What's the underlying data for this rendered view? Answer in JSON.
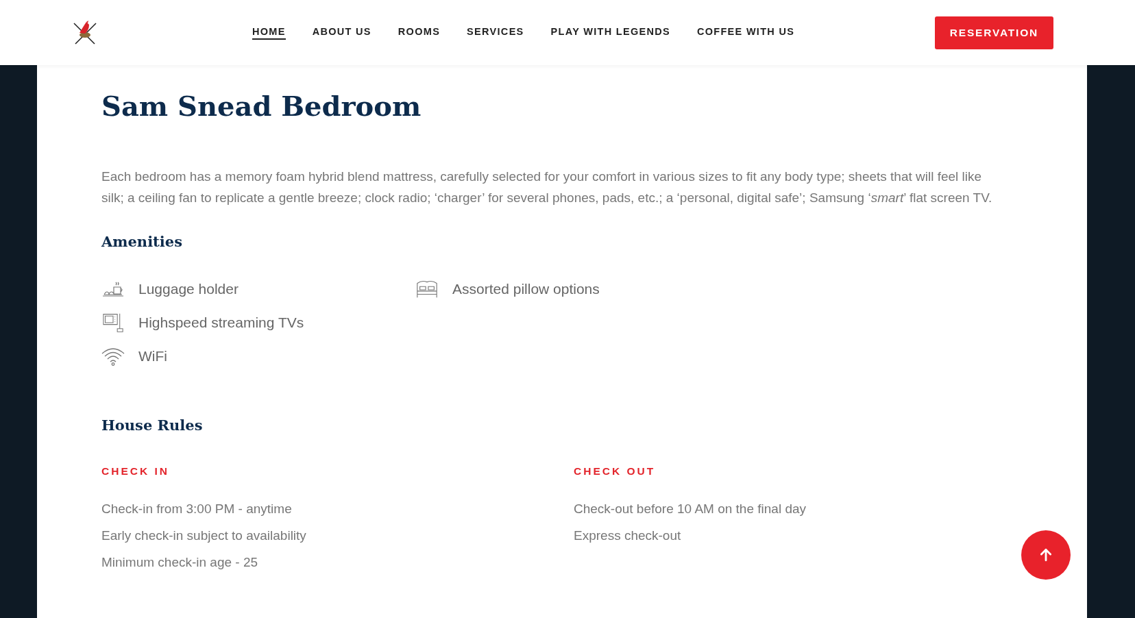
{
  "header": {
    "nav": [
      {
        "label": "HOME",
        "selected": true
      },
      {
        "label": "ABOUT US",
        "selected": false
      },
      {
        "label": "ROOMS",
        "selected": false
      },
      {
        "label": "SERVICES",
        "selected": false
      },
      {
        "label": "PLAY WITH LEGENDS",
        "selected": false
      },
      {
        "label": "COFFEE WITH US",
        "selected": false
      }
    ],
    "button": "RESERVATION"
  },
  "room": {
    "title": "Sam Snead Bedroom",
    "description": "Each bedroom has a memory foam hybrid blend mattress, carefully selected for your comfort in various sizes to fit any body type; sheets that will feel like silk; a ceiling fan to replicate a gentle breeze; clock radio; ‘charger’ for several phones, pads, etc.; a ‘personal, digital safe’; Samsung ‘*smart*’ flat screen TV."
  },
  "amenities": {
    "heading": "Amenities",
    "columns": [
      [
        {
          "kind": "tray",
          "label": "Luggage holder"
        },
        {
          "kind": "tv",
          "label": "Highspeed streaming TVs"
        },
        {
          "kind": "wifi",
          "label": "WiFi"
        }
      ],
      [
        {
          "kind": "bed",
          "label": "Assorted pillow options"
        }
      ]
    ]
  },
  "house_rules": {
    "heading": "House Rules",
    "groups": [
      {
        "title": "CHECK IN",
        "lines": [
          "Check-in from 3:00 PM - anytime",
          "Early check-in subject to availability",
          "Minimum check-in age - 25"
        ]
      },
      {
        "title": "CHECK OUT",
        "lines": [
          "Check-out before 10 AM on the final day",
          "Express check-out"
        ]
      }
    ]
  }
}
